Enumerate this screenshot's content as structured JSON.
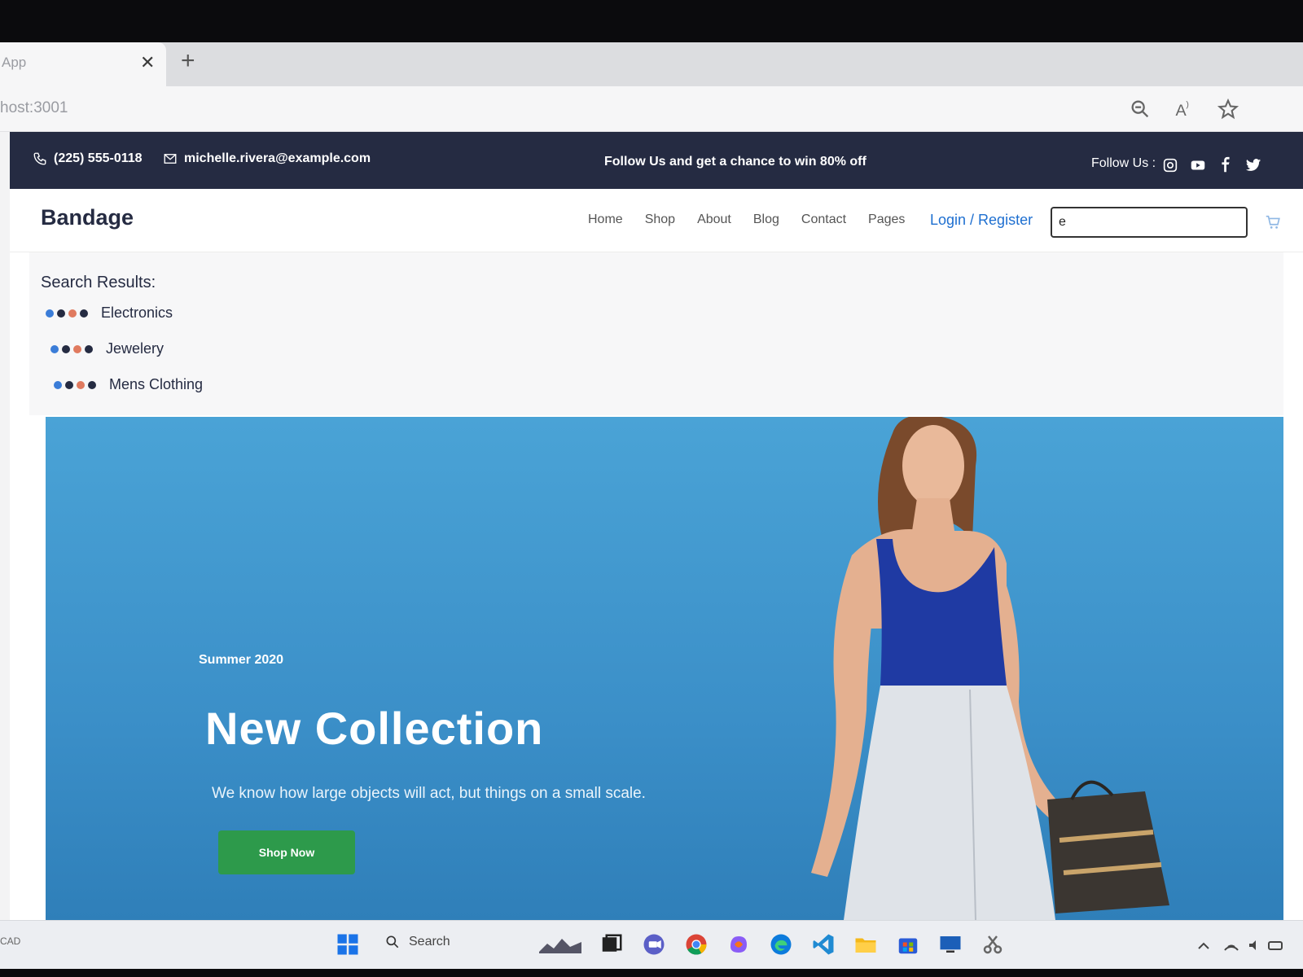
{
  "browser": {
    "tab_title": "App",
    "tab_close": "✕",
    "new_tab": "+",
    "url": "host:3001"
  },
  "topbar": {
    "phone": "(225) 555-0118",
    "email": "michelle.rivera@example.com",
    "promo": "Follow Us and get a chance to win 80% off",
    "follow_label": "Follow Us :"
  },
  "navbar": {
    "brand": "Bandage",
    "links": [
      "Home",
      "Shop",
      "About",
      "Blog",
      "Contact",
      "Pages"
    ],
    "login": "Login / Register",
    "search_value": "e"
  },
  "search_results": {
    "title": "Search Results:",
    "items": [
      "Electronics",
      "Jewelery",
      "Mens Clothing"
    ],
    "dot_colors": [
      "#3b7dd8",
      "#252b42",
      "#e07a5f",
      "#252b42"
    ]
  },
  "hero": {
    "season": "Summer 2020",
    "headline": "New Collection",
    "description": "We know how large objects will act, but things on a small scale.",
    "cta": "Shop Now"
  },
  "taskbar": {
    "search_label": "Search",
    "left_text": "CAD"
  },
  "colors": {
    "topbar_bg": "#252b42",
    "link_blue": "#1e6fd0",
    "hero_blue": "#4aa3d6",
    "cta_green": "#2d9a4b"
  }
}
